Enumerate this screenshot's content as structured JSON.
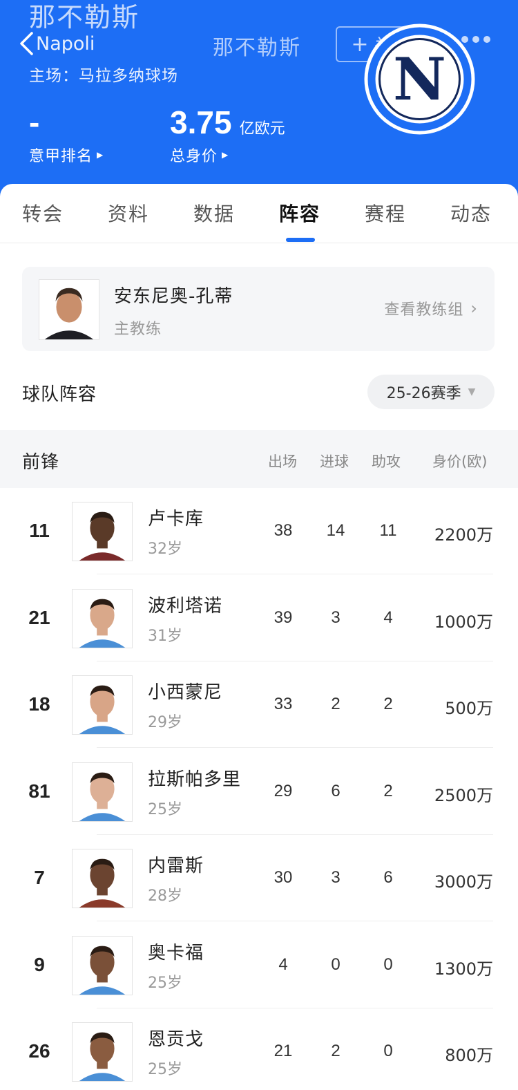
{
  "header": {
    "team_name_big": "那不勒斯",
    "back_label": "Napoli",
    "nav_title": "那不勒斯",
    "follow_label": "关注",
    "stadium": "主场：马拉多纳球场",
    "rank_value": "-",
    "rank_label": "意甲排名",
    "total_value": "3.75",
    "total_unit": "亿欧元",
    "total_label": "总身价",
    "logo_letter": "N",
    "colors": {
      "primary": "#1d6ef5",
      "logo_navy": "#13285c"
    }
  },
  "tabs": [
    "转会",
    "资料",
    "数据",
    "阵容",
    "赛程",
    "动态"
  ],
  "active_tab": "阵容",
  "coach": {
    "name": "安东尼奥-孔蒂",
    "role": "主教练",
    "link": "查看教练组"
  },
  "squad": {
    "title": "球队阵容",
    "season": "25-26赛季",
    "position": "前锋",
    "columns": [
      "出场",
      "进球",
      "助攻",
      "身价(欧)"
    ],
    "players": [
      {
        "number": "11",
        "name": "卢卡库",
        "age": "32岁",
        "apps": "38",
        "goals": "14",
        "assists": "11",
        "value": "2200万",
        "skin": "#5a3a28",
        "shirt": "#7a2a2a"
      },
      {
        "number": "21",
        "name": "波利塔诺",
        "age": "31岁",
        "apps": "39",
        "goals": "3",
        "assists": "4",
        "value": "1000万",
        "skin": "#d9a88a",
        "shirt": "#4a8fd6"
      },
      {
        "number": "18",
        "name": "小西蒙尼",
        "age": "29岁",
        "apps": "33",
        "goals": "2",
        "assists": "2",
        "value": "500万",
        "skin": "#d8a587",
        "shirt": "#4a8fd6"
      },
      {
        "number": "81",
        "name": "拉斯帕多里",
        "age": "25岁",
        "apps": "29",
        "goals": "6",
        "assists": "2",
        "value": "2500万",
        "skin": "#ddb096",
        "shirt": "#4a8fd6"
      },
      {
        "number": "7",
        "name": "内雷斯",
        "age": "28岁",
        "apps": "30",
        "goals": "3",
        "assists": "6",
        "value": "3000万",
        "skin": "#6b4430",
        "shirt": "#8a3a2a"
      },
      {
        "number": "9",
        "name": "奥卡福",
        "age": "25岁",
        "apps": "4",
        "goals": "0",
        "assists": "0",
        "value": "1300万",
        "skin": "#7a5038",
        "shirt": "#4a8fd6"
      },
      {
        "number": "26",
        "name": "恩贡戈",
        "age": "25岁",
        "apps": "21",
        "goals": "2",
        "assists": "0",
        "value": "800万",
        "skin": "#8a5c40",
        "shirt": "#4a8fd6"
      }
    ]
  }
}
